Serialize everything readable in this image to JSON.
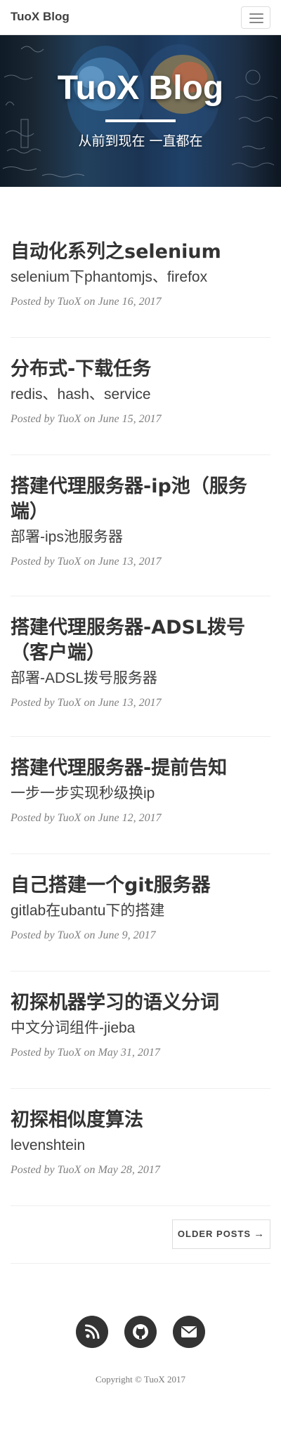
{
  "nav": {
    "brand": "TuoX Blog"
  },
  "header": {
    "title": "TuoX Blog",
    "subtitle": "从前到现在 一直都在"
  },
  "posts": [
    {
      "title": "自动化系列之selenium",
      "subtitle": "selenium下phantomjs、firefox",
      "meta_prefix": "Posted by ",
      "author": "TuoX",
      "date": "on June 16, 2017"
    },
    {
      "title": "分布式-下载任务",
      "subtitle": "redis、hash、service",
      "meta_prefix": "Posted by ",
      "author": "TuoX",
      "date": "on June 15, 2017"
    },
    {
      "title": "搭建代理服务器-ip池（服务端）",
      "subtitle": "部署-ips池服务器",
      "meta_prefix": "Posted by ",
      "author": "TuoX",
      "date": "on June 13, 2017"
    },
    {
      "title": "搭建代理服务器-ADSL拨号（客户端）",
      "subtitle": "部署-ADSL拨号服务器",
      "meta_prefix": "Posted by ",
      "author": "TuoX",
      "date": "on June 13, 2017"
    },
    {
      "title": "搭建代理服务器-提前告知",
      "subtitle": "一步一步实现秒级换ip",
      "meta_prefix": "Posted by ",
      "author": "TuoX",
      "date": "on June 12, 2017"
    },
    {
      "title": "自己搭建一个git服务器",
      "subtitle": "gitlab在ubantu下的搭建",
      "meta_prefix": "Posted by ",
      "author": "TuoX",
      "date": "on June 9, 2017"
    },
    {
      "title": "初探机器学习的语义分词",
      "subtitle": "中文分词组件-jieba",
      "meta_prefix": "Posted by ",
      "author": "TuoX",
      "date": "on May 31, 2017"
    },
    {
      "title": "初探相似度算法",
      "subtitle": "levenshtein",
      "meta_prefix": "Posted by ",
      "author": "TuoX",
      "date": "on May 28, 2017"
    }
  ],
  "pager": {
    "older_label": "OLDER POSTS",
    "arrow": "→"
  },
  "footer": {
    "social": [
      {
        "icon": "rss-icon"
      },
      {
        "icon": "github-icon"
      },
      {
        "icon": "email-icon"
      }
    ],
    "copyright": "Copyright © TuoX 2017"
  },
  "colors": {
    "text": "#404040",
    "meta": "#808080",
    "social_bg": "#333333",
    "divider": "#eeeeee"
  }
}
